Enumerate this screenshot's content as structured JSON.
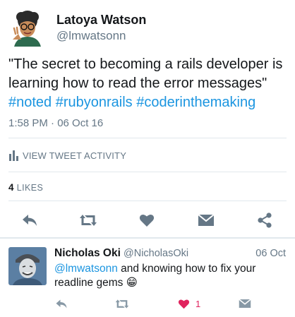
{
  "tweet": {
    "author_name": "Latoya Watson",
    "author_handle": "@lmwatsonn",
    "text_main": "\"The secret to becoming a rails developer is learning how to read the error messages\"",
    "hashtags": [
      "#noted",
      "#rubyonrails",
      "#coderinthemaking"
    ],
    "timestamp": "1:58 PM · 06 Oct 16",
    "activity_label": "VIEW TWEET ACTIVITY",
    "likes_count": "4",
    "likes_label": "LIKES"
  },
  "reply": {
    "author_name": "Nicholas Oki",
    "author_handle": "@NicholasOki",
    "date": "06 Oct",
    "mention": "@lmwatsonn",
    "text": " and knowing how to fix your readline gems",
    "emoji": "😁",
    "like_count": "1"
  },
  "icons": {
    "reply": "reply-icon",
    "retweet": "retweet-icon",
    "like": "heart-icon",
    "dm": "envelope-icon",
    "share": "share-icon",
    "activity": "bar-chart-icon"
  },
  "colors": {
    "link": "#1b95e0",
    "secondary_text": "#657786",
    "icon_gray": "#8899a6",
    "like_red": "#e0245e",
    "divider": "#e1e8ed"
  }
}
